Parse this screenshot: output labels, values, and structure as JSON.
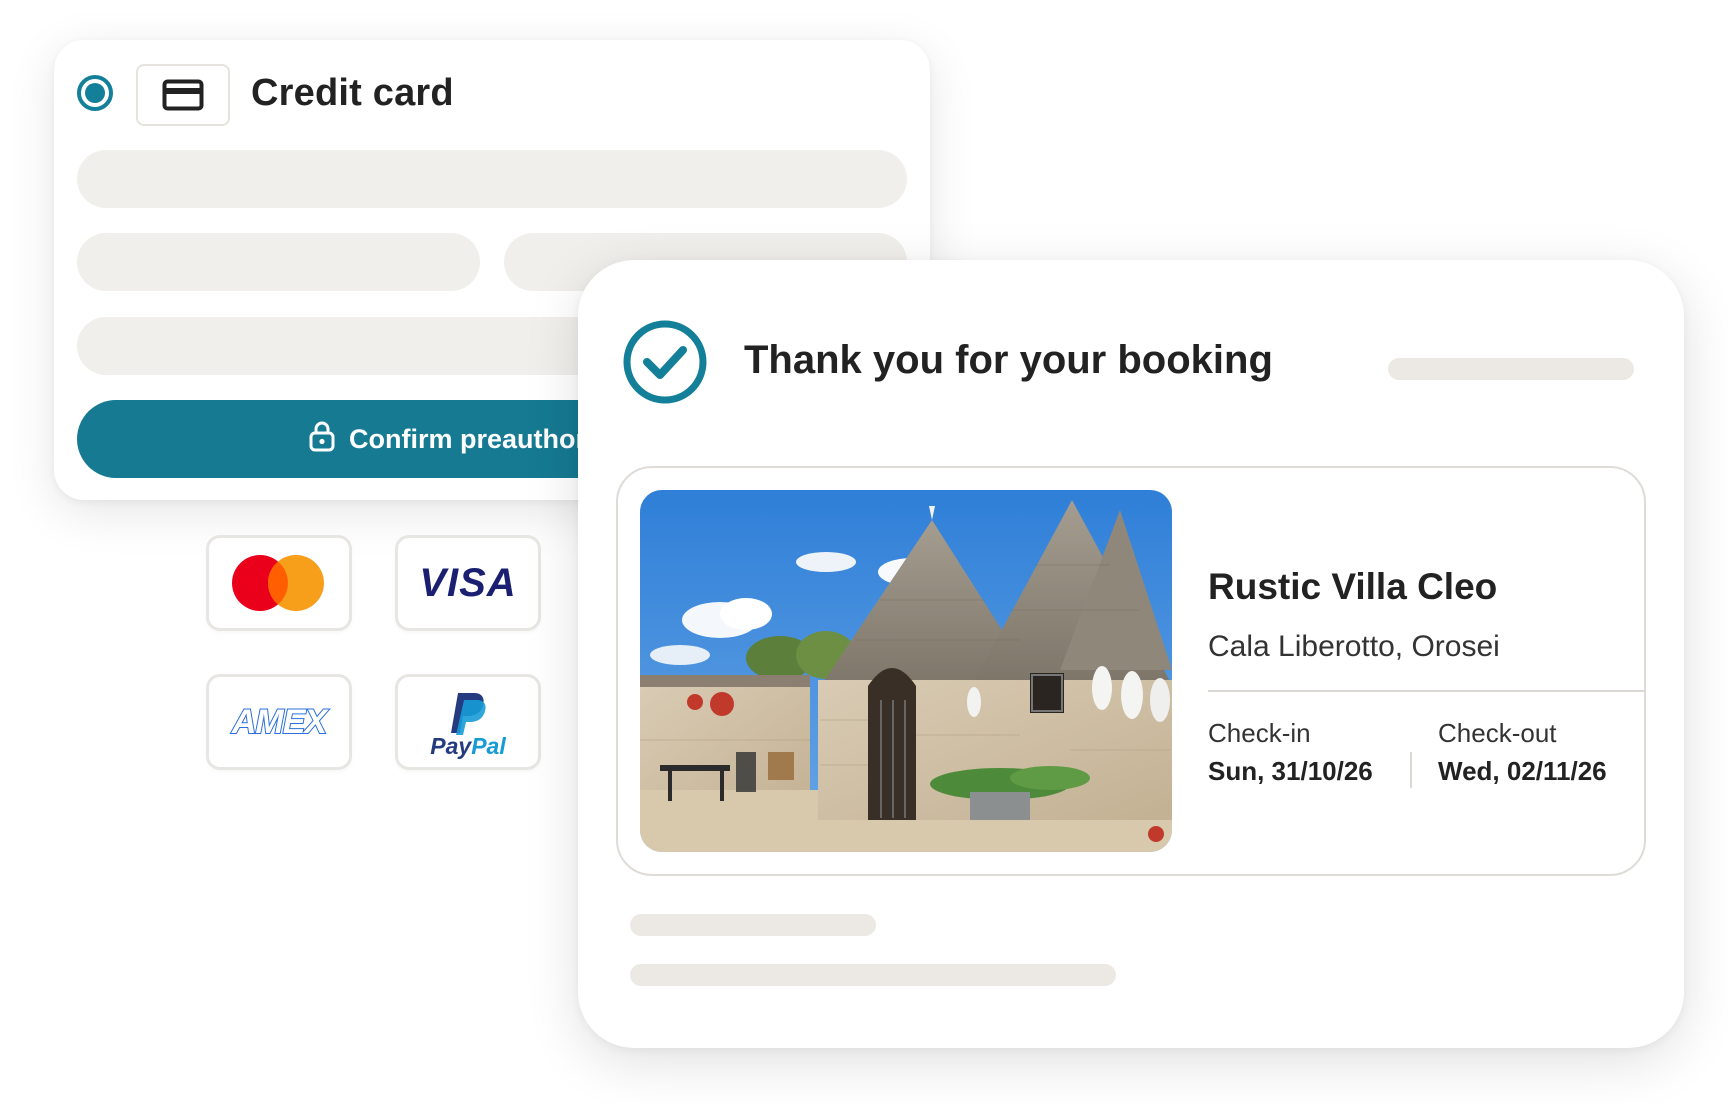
{
  "payment": {
    "method_label": "Credit card",
    "confirm_button_label": "Confirm preauthorization",
    "accent_color": "#157a92",
    "logos": [
      {
        "name": "mastercard",
        "text": ""
      },
      {
        "name": "visa",
        "text": "VISA"
      },
      {
        "name": "amex",
        "text": "AMEX"
      },
      {
        "name": "paypal",
        "text_pay": "Pay",
        "text_pal": "Pal"
      }
    ]
  },
  "booking": {
    "title": "Thank you for your booking",
    "property_name": "Rustic Villa Cleo",
    "location": "Cala Liberotto, Orosei",
    "checkin_label": "Check-in",
    "checkin_date": "Sun, 31/10/26",
    "checkout_label": "Check-out",
    "checkout_date": "Wed, 02/11/26"
  },
  "icons": [
    "radio-selected-icon",
    "credit-card-icon",
    "lock-icon",
    "check-circle-icon"
  ]
}
